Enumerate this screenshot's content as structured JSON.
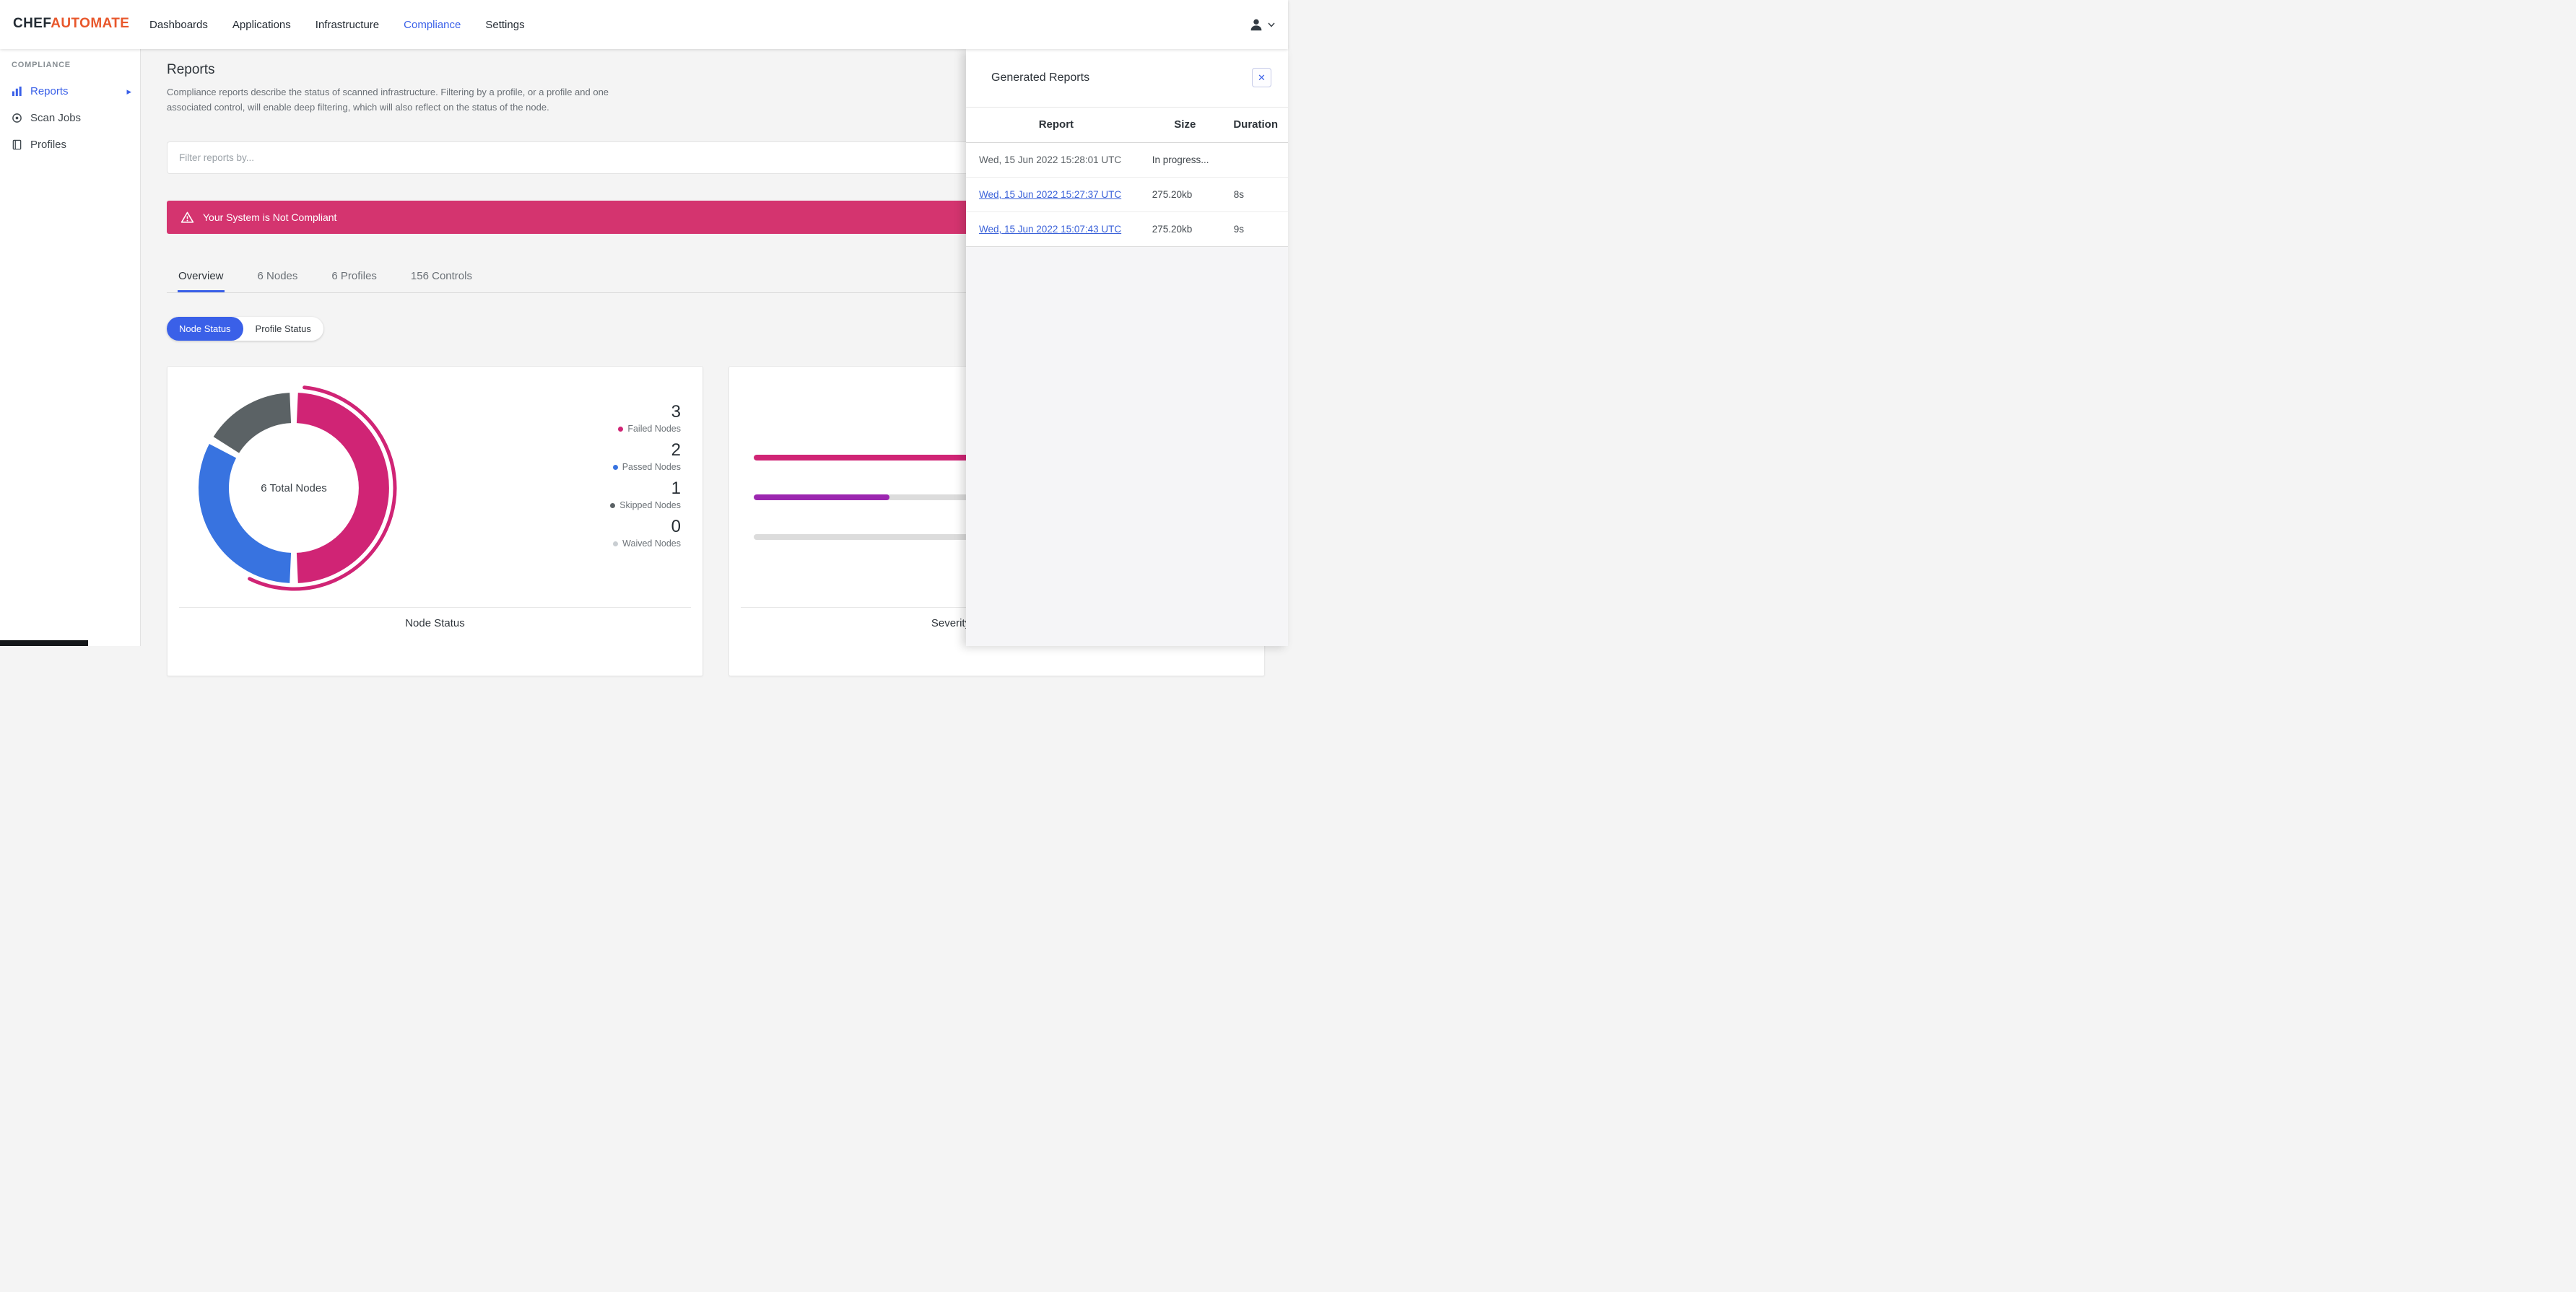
{
  "brand": {
    "name_primary": "CHEF",
    "name_secondary": "AUTOMATE"
  },
  "navbar": {
    "items": [
      {
        "label": "Dashboards",
        "active": false
      },
      {
        "label": "Applications",
        "active": false
      },
      {
        "label": "Infrastructure",
        "active": false
      },
      {
        "label": "Compliance",
        "active": true
      },
      {
        "label": "Settings",
        "active": false
      }
    ]
  },
  "sidebar": {
    "section_label": "COMPLIANCE",
    "items": [
      {
        "label": "Reports",
        "icon": "bar-chart-icon",
        "active": true
      },
      {
        "label": "Scan Jobs",
        "icon": "scan-target-icon",
        "active": false
      },
      {
        "label": "Profiles",
        "icon": "profiles-book-icon",
        "active": false
      }
    ]
  },
  "page": {
    "title": "Reports",
    "description": "Compliance reports describe the status of scanned infrastructure. Filtering by a profile, or a profile and one associated control, will enable deep filtering, which will also reflect on the status of the node.",
    "filter_placeholder": "Filter reports by...",
    "alert": {
      "message": "Your System is Not Compliant",
      "icon": "warning-triangle-icon"
    },
    "tabs": [
      {
        "label": "Overview",
        "active": true
      },
      {
        "label": "6 Nodes",
        "active": false
      },
      {
        "label": "6 Profiles",
        "active": false
      },
      {
        "label": "156 Controls",
        "active": false
      }
    ],
    "status_toggle": [
      {
        "label": "Node Status",
        "active": true
      },
      {
        "label": "Profile Status",
        "active": false
      }
    ]
  },
  "chart_data": [
    {
      "type": "pie",
      "variant": "donut",
      "title": "Node Status",
      "center_label": "6 Total Nodes",
      "categories": [
        "Failed Nodes",
        "Passed Nodes",
        "Skipped Nodes",
        "Waived Nodes"
      ],
      "values": [
        3,
        2,
        1,
        0
      ],
      "colors": [
        "#d02475",
        "#3873e0",
        "#5b6265",
        "#c9ced2"
      ],
      "legend_position": "right",
      "start_angle_deg": -90,
      "direction": "clockwise"
    },
    {
      "type": "bar",
      "orientation": "horizontal",
      "title": "Severity",
      "values_pct": [
        100,
        28,
        0
      ],
      "colors": [
        "#d02475",
        "#9c27b0",
        "#dcdcdc"
      ],
      "track_color": "#dcdcdc"
    }
  ],
  "generated_reports_panel": {
    "title": "Generated Reports",
    "close_icon": "✕",
    "table": {
      "headers": [
        "Report",
        "Size",
        "Duration"
      ],
      "rows": [
        {
          "report": "Wed, 15 Jun 2022 15:28:01 UTC",
          "size": "In progress...",
          "duration": "",
          "is_link": false
        },
        {
          "report": "Wed, 15 Jun 2022 15:27:37 UTC",
          "size": "275.20kb",
          "duration": "8s",
          "is_link": true
        },
        {
          "report": "Wed, 15 Jun 2022 15:07:43 UTC",
          "size": "275.20kb",
          "duration": "9s",
          "is_link": true
        }
      ]
    }
  },
  "colors": {
    "brand_orange": "#e8572b",
    "primary_blue": "#3a60e8",
    "alert_pink": "#d4346f",
    "failed_pink": "#d02475",
    "passed_blue": "#3873e0",
    "skipped_gray": "#5b6265",
    "waived_gray": "#c9ced2",
    "severity_purple": "#9c27b0",
    "page_bg": "#f4f4f4"
  }
}
